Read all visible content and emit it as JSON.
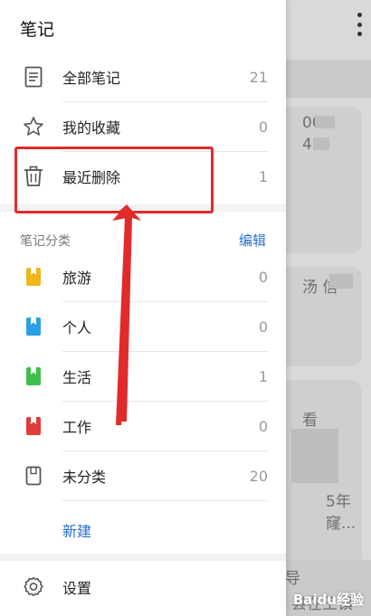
{
  "drawer": {
    "title": "笔记",
    "top_items": [
      {
        "label": "全部笔记",
        "count": "21",
        "icon": "document-icon"
      },
      {
        "label": "我的收藏",
        "count": "0",
        "icon": "star-icon"
      },
      {
        "label": "最近删除",
        "count": "1",
        "icon": "trash-icon"
      }
    ],
    "categories_header": "笔记分类",
    "edit_label": "编辑",
    "categories": [
      {
        "label": "旅游",
        "count": "0",
        "color": "#f2b61b"
      },
      {
        "label": "个人",
        "count": "0",
        "color": "#2aa0e6"
      },
      {
        "label": "生活",
        "count": "1",
        "color": "#3fbf49"
      },
      {
        "label": "工作",
        "count": "0",
        "color": "#e23b3b"
      },
      {
        "label": "未分类",
        "count": "20",
        "color": "#555555"
      }
    ],
    "new_label": "新建",
    "settings_label": "设置"
  },
  "background": {
    "card1_text": "00 1",
    "card1_text2": "4",
    "card2_text": "汤 信",
    "card3_text": "看",
    "card3_text2": "5年",
    "card3_text3": "窿...",
    "bottom_text": "导",
    "bottom_text2": "县在王镇"
  },
  "watermark": "Baidu经验"
}
